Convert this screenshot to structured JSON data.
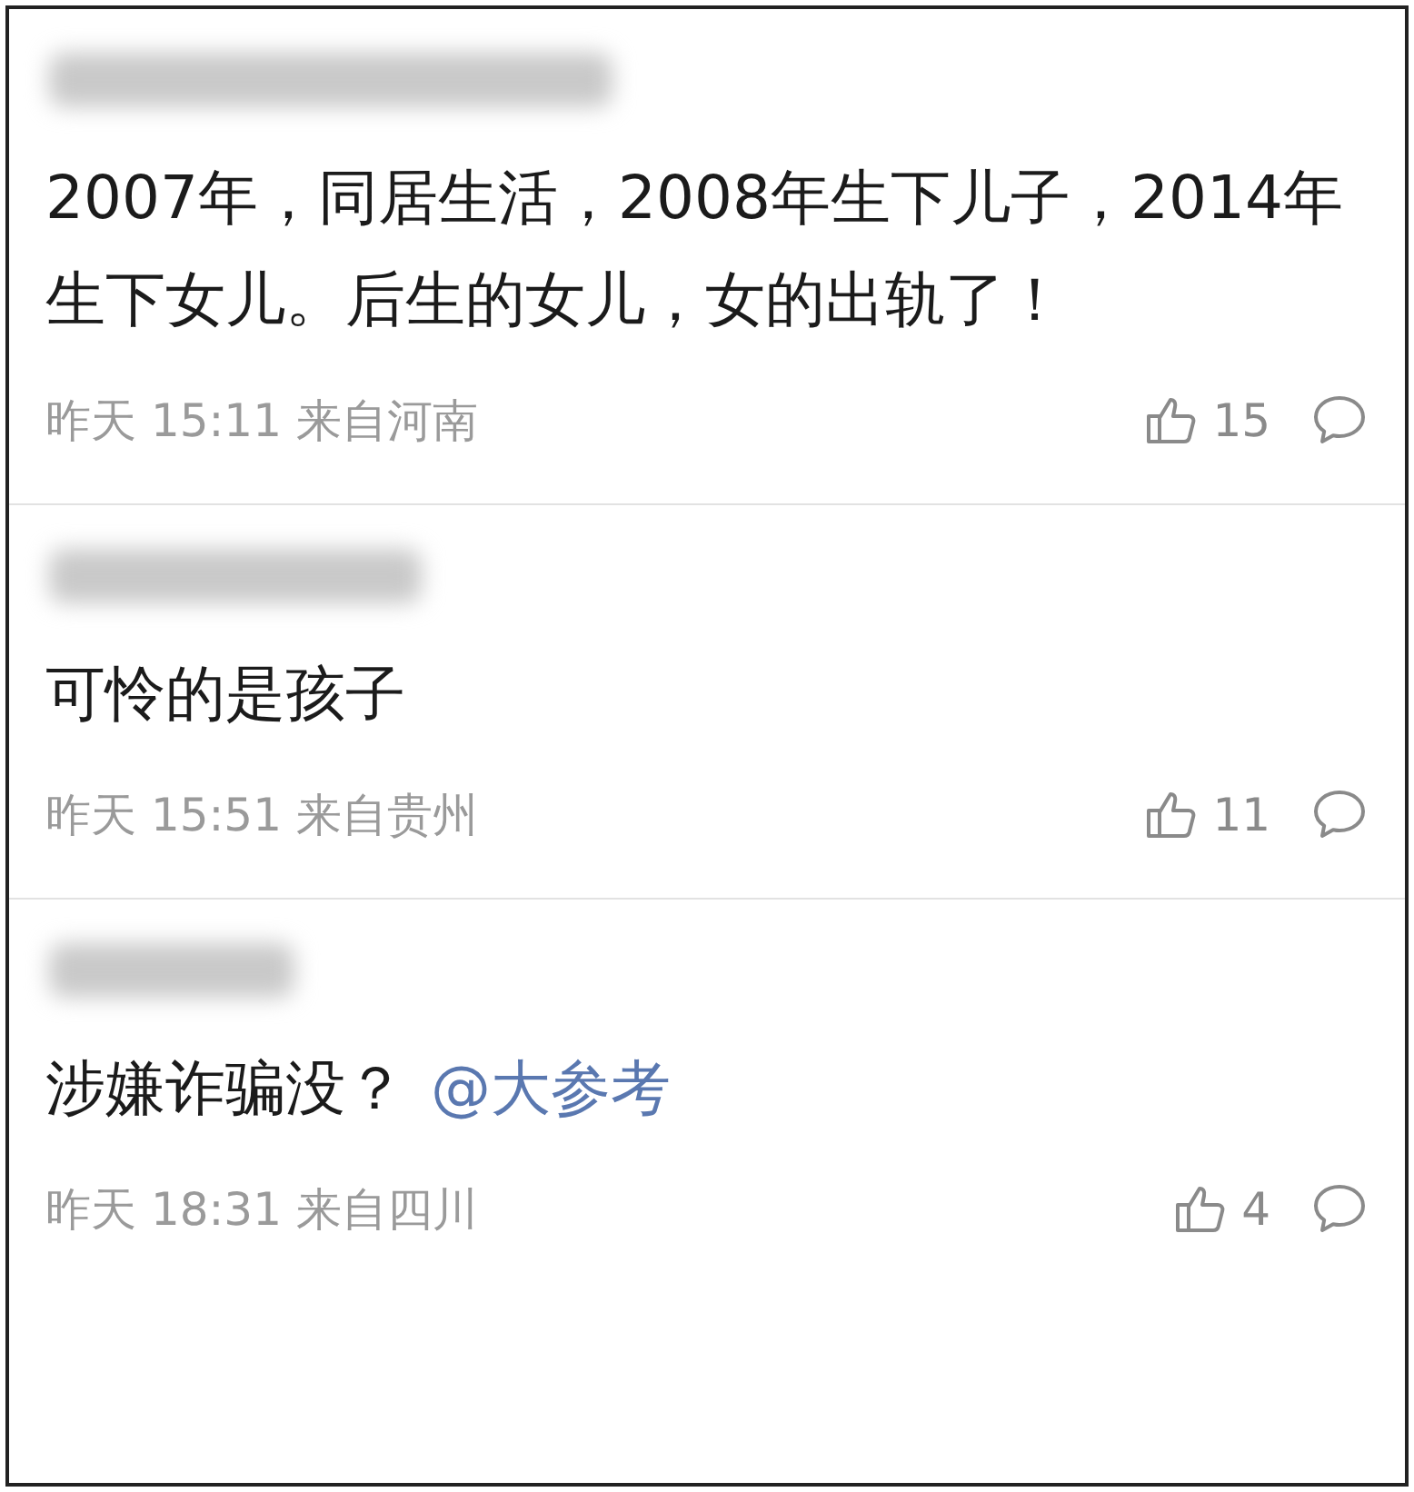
{
  "comments": [
    {
      "text": "2007年，同居生活，2008年生下儿子，2014年生下女儿。后生的女儿，女的出轨了！",
      "time": "昨天 15:11",
      "location": "来自河南",
      "likes": "15"
    },
    {
      "text": "可怜的是孩子",
      "time": "昨天 15:51",
      "location": "来自贵州",
      "likes": "11"
    },
    {
      "text": "涉嫌诈骗没？",
      "mention": "@大参考",
      "time": "昨天 18:31",
      "location": "来自四川",
      "likes": "4"
    }
  ]
}
